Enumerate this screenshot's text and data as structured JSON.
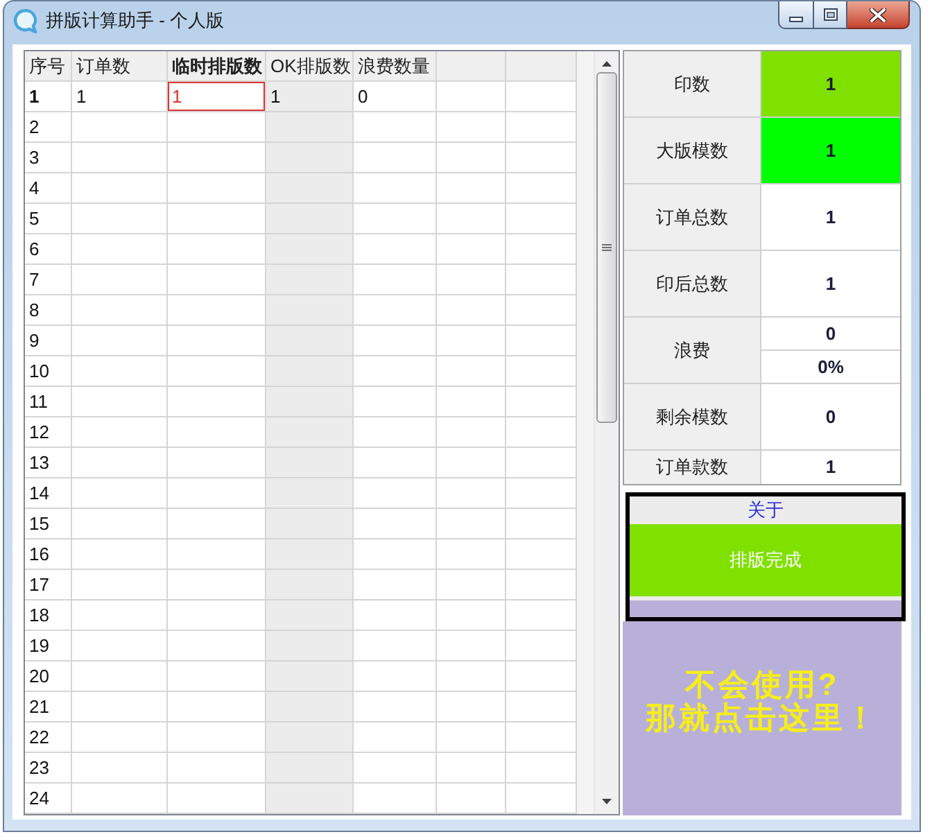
{
  "window": {
    "title": "拼版计算助手 - 个人版"
  },
  "grid": {
    "row_header_label": "序号",
    "columns": [
      {
        "label": "订单数",
        "selected": false,
        "readonly": false
      },
      {
        "label": "临时排版数",
        "selected": true,
        "readonly": false
      },
      {
        "label": "OK排版数",
        "selected": false,
        "readonly": true
      },
      {
        "label": "浪费数量",
        "selected": false,
        "readonly": false
      }
    ],
    "rows": [
      {
        "number": "1",
        "selected": true,
        "cells": [
          {
            "value": "1",
            "selected": false
          },
          {
            "value": "1",
            "selected": true
          },
          {
            "value": "1",
            "selected": false
          },
          {
            "value": "0",
            "selected": false
          }
        ]
      },
      {
        "number": "2",
        "selected": false
      },
      {
        "number": "3",
        "selected": false
      },
      {
        "number": "4",
        "selected": false
      },
      {
        "number": "5",
        "selected": false
      },
      {
        "number": "6",
        "selected": false
      },
      {
        "number": "7",
        "selected": false
      },
      {
        "number": "8",
        "selected": false
      },
      {
        "number": "9",
        "selected": false
      },
      {
        "number": "10",
        "selected": false
      },
      {
        "number": "11",
        "selected": false
      },
      {
        "number": "12",
        "selected": false
      },
      {
        "number": "13",
        "selected": false
      },
      {
        "number": "14",
        "selected": false
      },
      {
        "number": "15",
        "selected": false
      },
      {
        "number": "16",
        "selected": false
      },
      {
        "number": "17",
        "selected": false
      },
      {
        "number": "18",
        "selected": false
      },
      {
        "number": "19",
        "selected": false
      },
      {
        "number": "20",
        "selected": false
      },
      {
        "number": "21",
        "selected": false
      },
      {
        "number": "22",
        "selected": false
      },
      {
        "number": "23",
        "selected": false
      },
      {
        "number": "24",
        "selected": false
      }
    ]
  },
  "summary": [
    {
      "label": "印数",
      "kind": "single",
      "values": [
        "1"
      ],
      "color": "#80e000"
    },
    {
      "label": "大版模数",
      "kind": "single",
      "values": [
        "1"
      ],
      "color": "#00ff00"
    },
    {
      "label": "订单总数",
      "kind": "single",
      "values": [
        "1"
      ],
      "color": "#ffffff"
    },
    {
      "label": "印后总数",
      "kind": "single",
      "values": [
        "1"
      ],
      "color": "#ffffff"
    },
    {
      "label": "浪费",
      "kind": "split",
      "values": [
        "0",
        "0%"
      ],
      "color": "#ffffff"
    },
    {
      "label": "剩余模数",
      "kind": "single",
      "values": [
        "0"
      ],
      "color": "#ffffff"
    },
    {
      "label": "订单款数",
      "kind": "compact",
      "values": [
        "1"
      ],
      "color": "#ffffff"
    }
  ],
  "about_link": "关于",
  "finish_button": "排版完成",
  "help_banner": {
    "text": "不会使用?\n那就点击这里！"
  }
}
